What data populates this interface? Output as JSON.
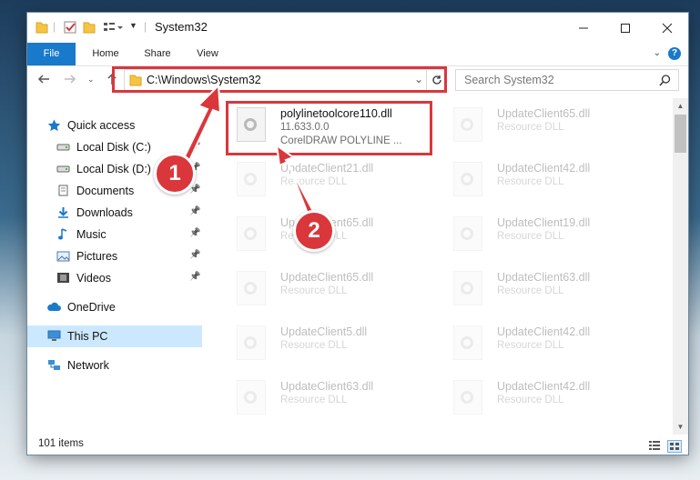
{
  "window": {
    "title": "System32",
    "ribbon_tabs": [
      "File",
      "Home",
      "Share",
      "View"
    ],
    "help": "?"
  },
  "address": {
    "path": "C:\\Windows\\System32",
    "search_placeholder": "Search System32"
  },
  "nav": {
    "items": [
      {
        "label": "Quick access",
        "icon": "star-icon",
        "pinned": false
      },
      {
        "label": "Local Disk (C:)",
        "icon": "drive-icon",
        "pinned": true
      },
      {
        "label": "Local Disk (D:)",
        "icon": "drive-icon",
        "pinned": true
      },
      {
        "label": "Documents",
        "icon": "documents-icon",
        "pinned": true
      },
      {
        "label": "Downloads",
        "icon": "downloads-icon",
        "pinned": true
      },
      {
        "label": "Music",
        "icon": "music-icon",
        "pinned": true
      },
      {
        "label": "Pictures",
        "icon": "pictures-icon",
        "pinned": true
      },
      {
        "label": "Videos",
        "icon": "videos-icon",
        "pinned": true
      },
      {
        "label": "OneDrive",
        "icon": "cloud-icon",
        "pinned": false
      },
      {
        "label": "This PC",
        "icon": "computer-icon",
        "pinned": false,
        "selected": true
      },
      {
        "label": "Network",
        "icon": "network-icon",
        "pinned": false
      }
    ]
  },
  "files": {
    "selected": {
      "name": "polylinetoolcore110.dll",
      "version": "11.633.0.0",
      "description": "CorelDRAW POLYLINE ..."
    },
    "others": [
      {
        "name": "UpdateClient65.dll",
        "type": "Resource DLL"
      },
      {
        "name": "UpdateClient21.dll",
        "type": "Resource DLL"
      },
      {
        "name": "UpdateClient42.dll",
        "type": "Resource DLL"
      },
      {
        "name": "UpdateClient65.dll",
        "type": "Resource DLL"
      },
      {
        "name": "UpdateClient19.dll",
        "type": "Resource DLL"
      },
      {
        "name": "UpdateClient65.dll",
        "type": "Resource DLL"
      },
      {
        "name": "UpdateClient63.dll",
        "type": "Resource DLL"
      },
      {
        "name": "UpdateClient5.dll",
        "type": "Resource DLL"
      },
      {
        "name": "UpdateClient42.dll",
        "type": "Resource DLL"
      },
      {
        "name": "UpdateClient63.dll",
        "type": "Resource DLL"
      },
      {
        "name": "UpdateClient42.dll",
        "type": "Resource DLL"
      }
    ]
  },
  "status": {
    "item_count": "101 items"
  },
  "callouts": [
    "1",
    "2"
  ],
  "colors": {
    "accent": "#1979ca",
    "highlight": "#d9373c",
    "selection": "#cce8ff"
  }
}
